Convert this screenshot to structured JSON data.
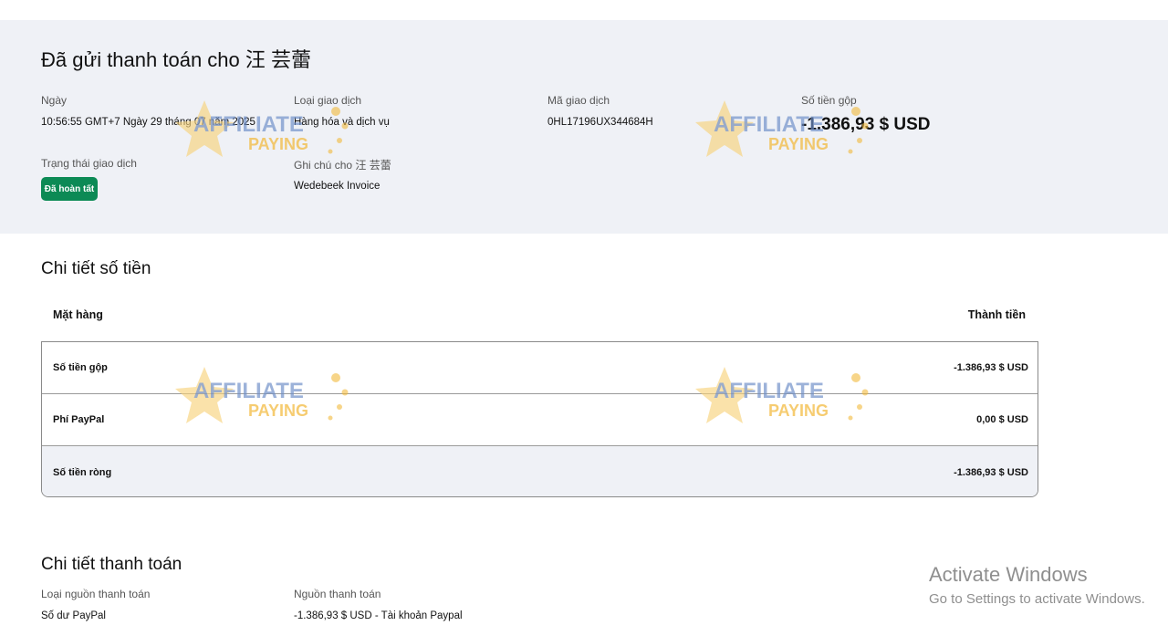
{
  "summary": {
    "title": "Đã gửi thanh toán cho 汪 芸蕾",
    "date_label": "Ngày",
    "date_value": "10:56:55 GMT+7 Ngày 29 tháng 07 năm 2025",
    "type_label": "Loại giao dịch",
    "type_value": "Hàng hóa và dịch vụ",
    "id_label": "Mã giao dịch",
    "id_value": "0HL17196UX344684H",
    "gross_label": "Số tiền gộp",
    "gross_value": "-1.386,93 $ USD",
    "status_label": "Trạng thái giao dịch",
    "status_value": "Đã hoàn tất",
    "note_label": "Ghi chú cho 汪 芸蕾",
    "note_value": "Wedebeek Invoice"
  },
  "amount_details": {
    "title": "Chi tiết số tiền",
    "col_item": "Mặt hàng",
    "col_total": "Thành tiền",
    "rows": [
      {
        "label": "Số tiền gộp",
        "value": "-1.386,93 $ USD"
      },
      {
        "label": "Phí PayPal",
        "value": "0,00 $ USD"
      },
      {
        "label": "Số tiền ròng",
        "value": "-1.386,93 $ USD"
      }
    ]
  },
  "payment_details": {
    "title": "Chi tiết thanh toán",
    "source_type_label": "Loại nguồn thanh toán",
    "source_type_value": "Số dư PayPal",
    "source_label": "Nguồn thanh toán",
    "source_value": "-1.386,93 $ USD - Tài khoản Paypal"
  },
  "windows": {
    "title": "Activate Windows",
    "subtitle": "Go to Settings to activate Windows."
  },
  "watermark": {
    "word1": "AFFILIATE",
    "word2": "PAYING",
    "colors": {
      "blue": "#6f8fc9",
      "gold": "#f2b93b",
      "star": "#f7d27a"
    }
  },
  "colors": {
    "band": "#eff1f6",
    "status": "#0c8a55"
  }
}
